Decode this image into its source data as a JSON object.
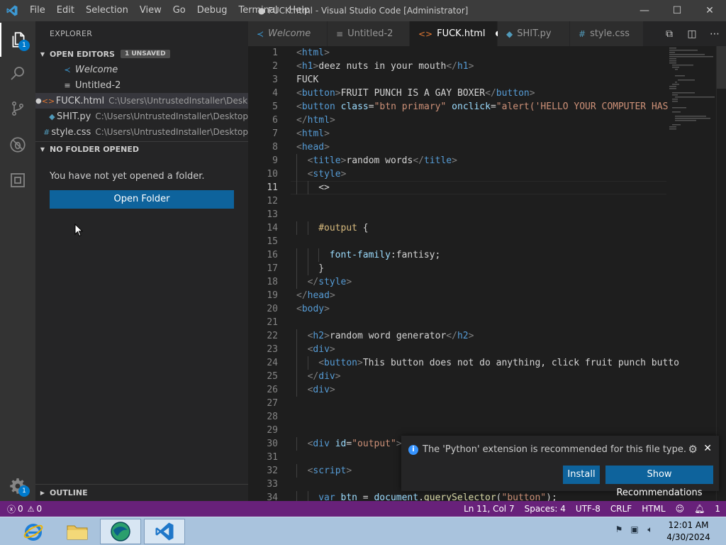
{
  "window": {
    "title": "● FUCK.html - Visual Studio Code [Administrator]",
    "menu": [
      "File",
      "Edit",
      "Selection",
      "View",
      "Go",
      "Debug",
      "Terminal",
      "Help"
    ],
    "minimize": "—",
    "maximize": "☐",
    "close": "✕"
  },
  "activity": {
    "explorer_badge": "1",
    "settings_badge": "1"
  },
  "sidebar": {
    "title": "EXPLORER",
    "open_editors_label": "OPEN EDITORS",
    "unsaved_badge": "1 UNSAVED",
    "editors": [
      {
        "name": "Welcome",
        "path": "",
        "icon": "≺",
        "icon_color": "#3c99d4"
      },
      {
        "name": "Untitled-2",
        "path": "",
        "icon": "≡",
        "icon_color": "#cccccc"
      },
      {
        "name": "FUCK.html",
        "path": "C:\\Users\\UntrustedInstaller\\Desk...",
        "icon": "<>",
        "icon_color": "#e37933"
      },
      {
        "name": "SHIT.py",
        "path": "C:\\Users\\UntrustedInstaller\\Desktop",
        "icon": "◆",
        "icon_color": "#519aba"
      },
      {
        "name": "style.css",
        "path": "C:\\Users\\UntrustedInstaller\\Desktop",
        "icon": "#",
        "icon_color": "#519aba"
      }
    ],
    "no_folder_label": "NO FOLDER OPENED",
    "no_folder_text": "You have not yet opened a folder.",
    "open_folder_button": "Open Folder",
    "outline_label": "OUTLINE"
  },
  "tabs": [
    {
      "label": "Welcome",
      "icon": "≺",
      "icon_color": "#3c99d4"
    },
    {
      "label": "Untitled-2",
      "icon": "≡",
      "icon_color": "#cccccc"
    },
    {
      "label": "FUCK.html",
      "icon": "<>",
      "icon_color": "#e37933",
      "dirty": "●"
    },
    {
      "label": "SHIT.py",
      "icon": "◆",
      "icon_color": "#519aba"
    },
    {
      "label": "style.css",
      "icon": "#",
      "icon_color": "#519aba"
    }
  ],
  "editor": {
    "current_line": 11,
    "lines": [
      {
        "n": 1,
        "indent": 0,
        "t": [
          [
            "br",
            "<"
          ],
          [
            "tag",
            "html"
          ],
          [
            "br",
            ">"
          ]
        ]
      },
      {
        "n": 2,
        "indent": 0,
        "t": [
          [
            "br",
            "<"
          ],
          [
            "tag",
            "h1"
          ],
          [
            "br",
            ">"
          ],
          [
            "txt",
            "deez nuts in your mouth"
          ],
          [
            "br",
            "</"
          ],
          [
            "tag",
            "h1"
          ],
          [
            "br",
            ">"
          ]
        ]
      },
      {
        "n": 3,
        "indent": 0,
        "t": [
          [
            "txt",
            "FUCK"
          ]
        ]
      },
      {
        "n": 4,
        "indent": 0,
        "t": [
          [
            "br",
            "<"
          ],
          [
            "tag",
            "button"
          ],
          [
            "br",
            ">"
          ],
          [
            "txt",
            "FRUIT PUNCH IS A GAY BOXER"
          ],
          [
            "br",
            "</"
          ],
          [
            "tag",
            "button"
          ],
          [
            "br",
            ">"
          ]
        ]
      },
      {
        "n": 5,
        "indent": 0,
        "t": [
          [
            "br",
            "<"
          ],
          [
            "tag",
            "button"
          ],
          [
            "txt",
            " "
          ],
          [
            "attr",
            "class"
          ],
          [
            "txt",
            "="
          ],
          [
            "str",
            "\"btn primary\""
          ],
          [
            "txt",
            " "
          ],
          [
            "attr",
            "onclick"
          ],
          [
            "txt",
            "="
          ],
          [
            "str",
            "\"alert('HELLO YOUR COMPUTER HAS"
          ]
        ]
      },
      {
        "n": 6,
        "indent": 0,
        "t": [
          [
            "br",
            "</"
          ],
          [
            "tag",
            "html"
          ],
          [
            "br",
            ">"
          ]
        ]
      },
      {
        "n": 7,
        "indent": 0,
        "t": [
          [
            "br",
            "<"
          ],
          [
            "tag",
            "html"
          ],
          [
            "br",
            ">"
          ]
        ]
      },
      {
        "n": 8,
        "indent": 0,
        "t": [
          [
            "br",
            "<"
          ],
          [
            "tag",
            "head"
          ],
          [
            "br",
            ">"
          ]
        ]
      },
      {
        "n": 9,
        "indent": 1,
        "t": [
          [
            "br",
            "<"
          ],
          [
            "tag",
            "title"
          ],
          [
            "br",
            ">"
          ],
          [
            "txt",
            "random words"
          ],
          [
            "br",
            "</"
          ],
          [
            "tag",
            "title"
          ],
          [
            "br",
            ">"
          ]
        ]
      },
      {
        "n": 10,
        "indent": 1,
        "t": [
          [
            "br",
            "<"
          ],
          [
            "tag",
            "style"
          ],
          [
            "br",
            ">"
          ]
        ]
      },
      {
        "n": 11,
        "indent": 2,
        "t": [
          [
            "txt",
            "<>"
          ]
        ]
      },
      {
        "n": 12,
        "indent": 0,
        "t": []
      },
      {
        "n": 13,
        "indent": 0,
        "t": []
      },
      {
        "n": 14,
        "indent": 2,
        "t": [
          [
            "sel",
            "#output"
          ],
          [
            "txt",
            " {"
          ]
        ]
      },
      {
        "n": 15,
        "indent": 0,
        "t": []
      },
      {
        "n": 16,
        "indent": 3,
        "t": [
          [
            "prop",
            "font-family"
          ],
          [
            "txt",
            ":fantisy;"
          ]
        ]
      },
      {
        "n": 17,
        "indent": 2,
        "t": [
          [
            "txt",
            "}"
          ]
        ]
      },
      {
        "n": 18,
        "indent": 1,
        "t": [
          [
            "br",
            "</"
          ],
          [
            "tag",
            "style"
          ],
          [
            "br",
            ">"
          ]
        ]
      },
      {
        "n": 19,
        "indent": 0,
        "t": [
          [
            "br",
            "</"
          ],
          [
            "tag",
            "head"
          ],
          [
            "br",
            ">"
          ]
        ]
      },
      {
        "n": 20,
        "indent": 0,
        "t": [
          [
            "br",
            "<"
          ],
          [
            "tag",
            "body"
          ],
          [
            "br",
            ">"
          ]
        ]
      },
      {
        "n": 21,
        "indent": 0,
        "t": []
      },
      {
        "n": 22,
        "indent": 1,
        "t": [
          [
            "br",
            "<"
          ],
          [
            "tag",
            "h2"
          ],
          [
            "br",
            ">"
          ],
          [
            "txt",
            "random word generator"
          ],
          [
            "br",
            "</"
          ],
          [
            "tag",
            "h2"
          ],
          [
            "br",
            ">"
          ]
        ]
      },
      {
        "n": 23,
        "indent": 1,
        "t": [
          [
            "br",
            "<"
          ],
          [
            "tag",
            "div"
          ],
          [
            "br",
            ">"
          ]
        ]
      },
      {
        "n": 24,
        "indent": 2,
        "t": [
          [
            "br",
            "<"
          ],
          [
            "tag",
            "button"
          ],
          [
            "br",
            ">"
          ],
          [
            "txt",
            "This button does not do anything, click fruit punch butto"
          ]
        ]
      },
      {
        "n": 25,
        "indent": 1,
        "t": [
          [
            "br",
            "</"
          ],
          [
            "tag",
            "div"
          ],
          [
            "br",
            ">"
          ]
        ]
      },
      {
        "n": 26,
        "indent": 1,
        "t": [
          [
            "br",
            "<"
          ],
          [
            "tag",
            "div"
          ],
          [
            "br",
            ">"
          ]
        ]
      },
      {
        "n": 27,
        "indent": 0,
        "t": []
      },
      {
        "n": 28,
        "indent": 0,
        "t": []
      },
      {
        "n": 29,
        "indent": 0,
        "t": []
      },
      {
        "n": 30,
        "indent": 1,
        "t": [
          [
            "br",
            "<"
          ],
          [
            "tag",
            "div"
          ],
          [
            "txt",
            " "
          ],
          [
            "attr",
            "id"
          ],
          [
            "txt",
            "="
          ],
          [
            "str",
            "\"output\""
          ],
          [
            "br",
            ">"
          ]
        ]
      },
      {
        "n": 31,
        "indent": 0,
        "t": []
      },
      {
        "n": 32,
        "indent": 1,
        "t": [
          [
            "br",
            "<"
          ],
          [
            "tag",
            "script"
          ],
          [
            "br",
            ">"
          ]
        ]
      },
      {
        "n": 33,
        "indent": 0,
        "t": []
      },
      {
        "n": 34,
        "indent": 2,
        "t": [
          [
            "kw",
            "var"
          ],
          [
            "txt",
            " "
          ],
          [
            "attr",
            "btn"
          ],
          [
            "txt",
            " = "
          ],
          [
            "attr",
            "document"
          ],
          [
            "txt",
            "."
          ],
          [
            "fn",
            "querySelector"
          ],
          [
            "txt",
            "("
          ],
          [
            "str",
            "\"button\""
          ],
          [
            "txt",
            ");"
          ]
        ]
      }
    ]
  },
  "notification": {
    "message": "The 'Python' extension is recommended for this file type.",
    "install": "Install",
    "show": "Show Recommendations"
  },
  "status": {
    "errors": "0",
    "warnings": "0",
    "position": "Ln 11, Col 7",
    "spaces": "Spaces: 4",
    "encoding": "UTF-8",
    "eol": "CRLF",
    "language": "HTML",
    "bell_count": "1"
  },
  "taskbar": {
    "time": "12:01 AM",
    "date": "4/30/2024"
  },
  "colors": {
    "accent": "#007acc",
    "statusbar": "#68217a",
    "button": "#0e639c"
  }
}
